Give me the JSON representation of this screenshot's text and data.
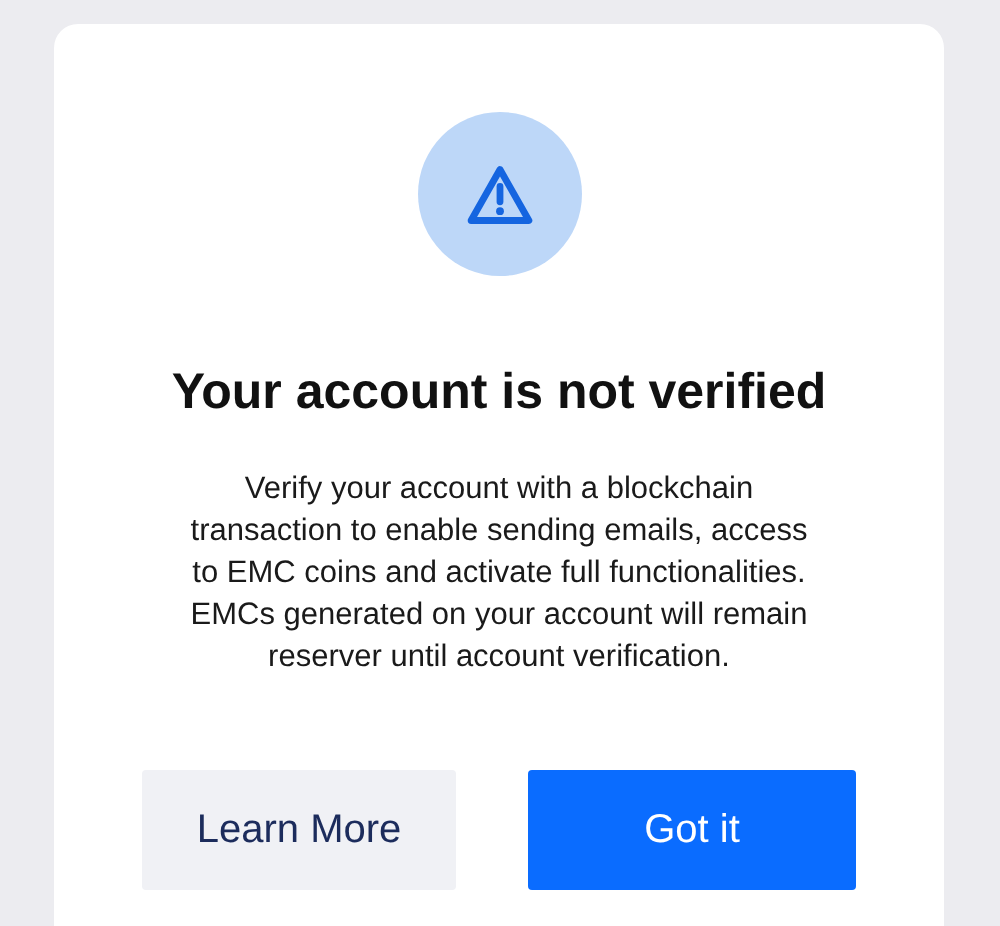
{
  "dialog": {
    "title": "Your account is not verified",
    "message": "Verify your account with a blockchain transaction to enable sending emails, access to EMC coins and activate full functionalities. EMCs generated on your account will remain reserver until account verification.",
    "buttons": [
      {
        "label": "Learn More",
        "kind": "secondary"
      },
      {
        "label": "Got it",
        "kind": "primary"
      }
    ]
  }
}
